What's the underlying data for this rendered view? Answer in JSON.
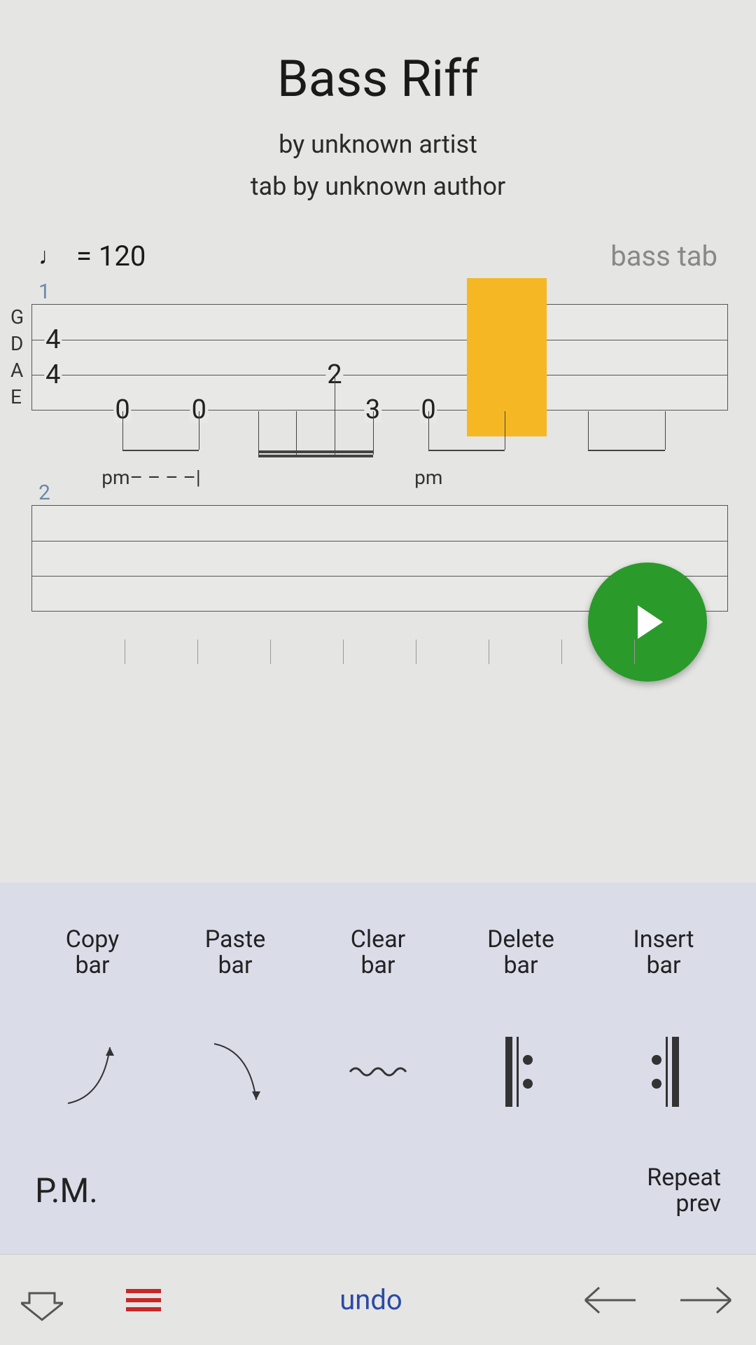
{
  "header": {
    "title": "Bass Riff",
    "artist_line": "by unknown artist",
    "author_line": "tab by unknown author"
  },
  "meta": {
    "tempo_value": "= 120",
    "track_type": "bass tab"
  },
  "strings": [
    "G",
    "D",
    "A",
    "E"
  ],
  "bar_numbers": {
    "bar1": "1",
    "bar2": "2"
  },
  "tab": {
    "notes": {
      "d4": "4",
      "a4": "4",
      "e0a": "0",
      "e0b": "0",
      "a2": "2",
      "e3": "3",
      "e0c": "0"
    },
    "pm1": "pm– – – –|",
    "pm2": "pm"
  },
  "toolbar": {
    "copy": "Copy\nbar",
    "paste": "Paste\nbar",
    "clear": "Clear\nbar",
    "delete": "Delete\nbar",
    "insert": "Insert\nbar",
    "pm": "P.M.",
    "repeat_prev": "Repeat\nprev"
  },
  "bottom": {
    "undo": "undo"
  }
}
